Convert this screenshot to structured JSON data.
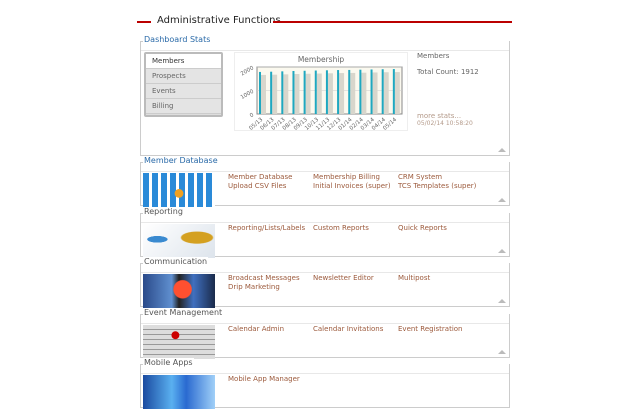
{
  "header": {
    "title": "Administrative Functions"
  },
  "dashboard": {
    "label": "Dashboard Stats",
    "tabs": [
      "Members",
      "Prospects",
      "Events",
      "Billing"
    ],
    "active_tab": "Members",
    "stats_title": "Members",
    "total": "Total Count: 1912",
    "more": "more stats...",
    "timestamp": "05/02/14 10:58:20"
  },
  "chart_data": {
    "type": "bar",
    "title": "Membership",
    "categories": [
      "05/13",
      "06/13",
      "07/13",
      "08/13",
      "09/13",
      "10/13",
      "11/13",
      "12/13",
      "01/14",
      "02/14",
      "03/14",
      "04/14",
      "05/14"
    ],
    "values": [
      1790,
      1800,
      1815,
      1830,
      1840,
      1850,
      1860,
      1870,
      1875,
      1885,
      1895,
      1905,
      1912
    ],
    "ylim": [
      0,
      2000
    ],
    "yticks": [
      "0",
      "1000",
      "2000"
    ],
    "colors": {
      "bar": "#1fa8c0",
      "shadow": "#d8d6cc",
      "bg": "#fbf9ef"
    }
  },
  "sections": [
    {
      "label": "Member Database",
      "links": [
        [
          "Member Database",
          "Upload CSV Files"
        ],
        [
          "Membership Billing",
          "Initial Invoices (super)"
        ],
        [
          "CRM System",
          "TCS Templates (super)"
        ]
      ]
    },
    {
      "label": "Reporting",
      "links": [
        [
          "Reporting/Lists/Labels"
        ],
        [
          "Custom Reports"
        ],
        [
          "Quick Reports"
        ]
      ]
    },
    {
      "label": "Communication",
      "links": [
        [
          "Broadcast Messages",
          "Drip Marketing"
        ],
        [
          "Newsletter Editor"
        ],
        [
          "Multipost"
        ]
      ]
    },
    {
      "label": "Event Management",
      "links": [
        [
          "Calendar Admin"
        ],
        [
          "Calendar Invitations"
        ],
        [
          "Event Registration"
        ]
      ]
    },
    {
      "label": "Mobile Apps",
      "links": [
        [
          "Mobile App Manager"
        ]
      ]
    }
  ]
}
